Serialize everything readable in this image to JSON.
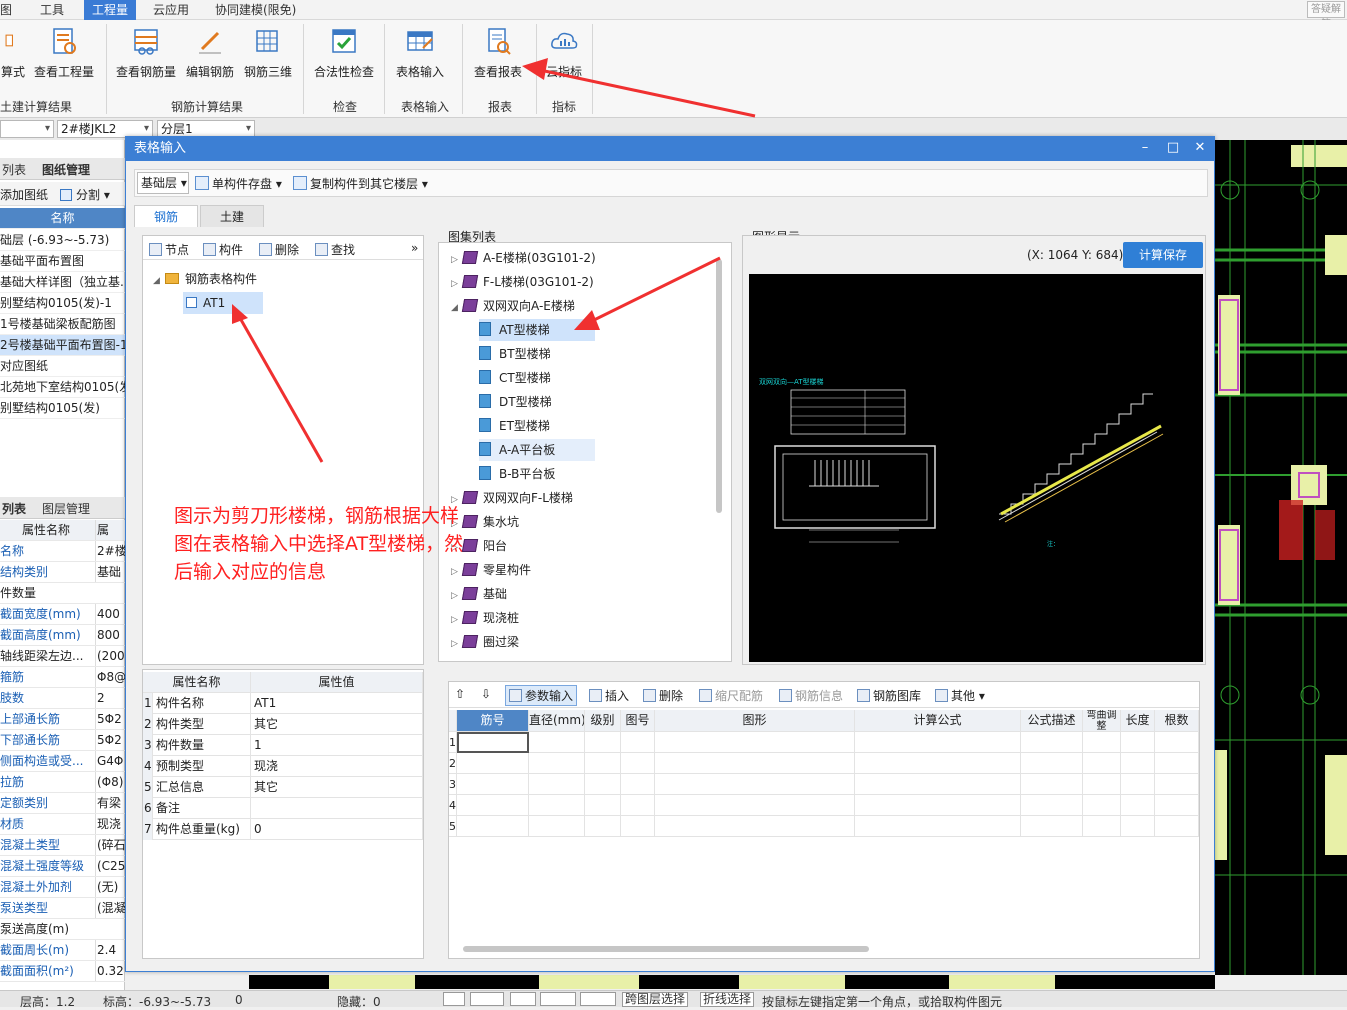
{
  "menubar": {
    "items": [
      "图",
      "工具",
      "工程量",
      "云应用",
      "协同建模(限免)"
    ],
    "active": "工程量",
    "hint": "答疑解答"
  },
  "ribbon": {
    "buttons": {
      "b0": "算式",
      "b1": "查看工程量",
      "b2": "查看钢筋量",
      "b3": "编辑钢筋",
      "b4": "钢筋三维",
      "b5": "合法性检查",
      "b6": "表格输入",
      "b7": "查看报表",
      "b8": "云指标"
    },
    "groups": {
      "g0": "土建计算结果",
      "g1": "钢筋计算结果",
      "g2": "检查",
      "g3": "表格输入",
      "g4": "报表",
      "g5": "指标"
    }
  },
  "row2": {
    "combo1": "",
    "combo2": "2#楼JKL2",
    "combo3": "分层1"
  },
  "leftpanel": {
    "tabs": {
      "t1": "列表",
      "t2": "图纸管理"
    },
    "tools": {
      "add": "添加图纸",
      "split": "分割"
    },
    "header": "名称",
    "items": [
      "础层 (-6.93~-5.73)",
      "基础平面布置图",
      "基础大样详图（独立基...",
      "别墅结构0105(发)-1",
      "1号楼基础梁板配筋图",
      "2号楼基础平面布置图-1",
      "对应图纸",
      "北苑地下室结构0105(发)",
      "别墅结构0105(发)"
    ],
    "tabs2": {
      "t1": "列表",
      "t2": "图层管理"
    },
    "prop_header": {
      "k": "属性名称",
      "v": "属"
    },
    "props": [
      {
        "k": "名称",
        "v": "2#楼",
        "blue": true
      },
      {
        "k": "结构类别",
        "v": "基础",
        "blue": true
      },
      {
        "k": "件数量",
        "v": "",
        "blue": false
      },
      {
        "k": "截面宽度(mm)",
        "v": "400",
        "blue": true
      },
      {
        "k": "截面高度(mm)",
        "v": "800",
        "blue": true
      },
      {
        "k": "轴线距梁左边...",
        "v": "(200)",
        "blue": false
      },
      {
        "k": "箍筋",
        "v": "Φ8@",
        "blue": true
      },
      {
        "k": "肢数",
        "v": "2",
        "blue": true
      },
      {
        "k": "上部通长筋",
        "v": "5Φ2",
        "blue": true
      },
      {
        "k": "下部通长筋",
        "v": "5Φ2",
        "blue": true
      },
      {
        "k": "侧面构造或受...",
        "v": "G4Φ",
        "blue": true
      },
      {
        "k": "拉筋",
        "v": "(Φ8)",
        "blue": true
      },
      {
        "k": "定额类别",
        "v": "有梁",
        "blue": true
      },
      {
        "k": "材质",
        "v": "现浇",
        "blue": true
      },
      {
        "k": "混凝土类型",
        "v": "(碎石",
        "blue": true
      },
      {
        "k": "混凝土强度等级",
        "v": "(C25)",
        "blue": true
      },
      {
        "k": "混凝土外加剂",
        "v": "(无)",
        "blue": true
      },
      {
        "k": "泵送类型",
        "v": "(混凝",
        "blue": true
      },
      {
        "k": "泵送高度(m)",
        "v": "",
        "blue": false
      },
      {
        "k": "截面周长(m)",
        "v": "2.4",
        "blue": true
      },
      {
        "k": "截面面积(m²)",
        "v": "0.32",
        "blue": true
      }
    ]
  },
  "dialog": {
    "title": "表格输入",
    "toolbar": {
      "floor": "基础层",
      "save": "单构件存盘",
      "copy": "复制构件到其它楼层"
    },
    "tabs": {
      "t1": "钢筋",
      "t2": "土建"
    },
    "tree_toolbar": {
      "node": "节点",
      "comp": "构件",
      "del": "删除",
      "find": "查找"
    },
    "tree": {
      "root": "钢筋表格构件",
      "child": "AT1"
    },
    "prop_grid": {
      "h1": "属性名称",
      "h2": "属性值",
      "rows": [
        {
          "n": "1",
          "k": "构件名称",
          "v": "AT1"
        },
        {
          "n": "2",
          "k": "构件类型",
          "v": "其它"
        },
        {
          "n": "3",
          "k": "构件数量",
          "v": "1"
        },
        {
          "n": "4",
          "k": "预制类型",
          "v": "现浇"
        },
        {
          "n": "5",
          "k": "汇总信息",
          "v": "其它"
        },
        {
          "n": "6",
          "k": "备注",
          "v": ""
        },
        {
          "n": "7",
          "k": "构件总重量(kg)",
          "v": "0"
        }
      ]
    },
    "atlas": {
      "label": "图集列表",
      "items": [
        {
          "t": "A-E楼梯(03G101-2)",
          "level": 0,
          "exp": "▷",
          "icon": "book"
        },
        {
          "t": "F-L楼梯(03G101-2)",
          "level": 0,
          "exp": "▷",
          "icon": "book"
        },
        {
          "t": "双网双向A-E楼梯",
          "level": 0,
          "exp": "◢",
          "icon": "book-open"
        },
        {
          "t": "AT型楼梯",
          "level": 1,
          "exp": "",
          "icon": "page",
          "sel": true
        },
        {
          "t": "BT型楼梯",
          "level": 1,
          "exp": "",
          "icon": "page"
        },
        {
          "t": "CT型楼梯",
          "level": 1,
          "exp": "",
          "icon": "page"
        },
        {
          "t": "DT型楼梯",
          "level": 1,
          "exp": "",
          "icon": "page"
        },
        {
          "t": "ET型楼梯",
          "level": 1,
          "exp": "",
          "icon": "page"
        },
        {
          "t": "A-A平台板",
          "level": 1,
          "exp": "",
          "icon": "page",
          "hl": true
        },
        {
          "t": "B-B平台板",
          "level": 1,
          "exp": "",
          "icon": "page"
        },
        {
          "t": "双网双向F-L楼梯",
          "level": 0,
          "exp": "▷",
          "icon": "book"
        },
        {
          "t": "集水坑",
          "level": 0,
          "exp": "▷",
          "icon": "book"
        },
        {
          "t": "阳台",
          "level": 0,
          "exp": "▷",
          "icon": "book"
        },
        {
          "t": "零星构件",
          "level": 0,
          "exp": "▷",
          "icon": "book"
        },
        {
          "t": "基础",
          "level": 0,
          "exp": "▷",
          "icon": "book"
        },
        {
          "t": "现浇桩",
          "level": 0,
          "exp": "▷",
          "icon": "book"
        },
        {
          "t": "圈过梁",
          "level": 0,
          "exp": "▷",
          "icon": "book"
        }
      ]
    },
    "figure": {
      "label": "图形显示",
      "coords": "(X: 1064 Y: 684)",
      "button": "计算保存",
      "drawing_title": "双网双向—AT型楼梯"
    },
    "rebar_toolbar": {
      "param": "参数输入",
      "insert": "插入",
      "del": "删除",
      "scale": "缩尺配筋",
      "info": "钢筋信息",
      "lib": "钢筋图库",
      "other": "其他"
    },
    "rebar_grid": {
      "cols": [
        "筋号",
        "直径(mm)",
        "级别",
        "图号",
        "图形",
        "计算公式",
        "公式描述",
        "弯曲调整",
        "长度",
        "根数"
      ],
      "rows": [
        "1",
        "2",
        "3",
        "4",
        "5"
      ]
    }
  },
  "annotation": "图示为剪刀形楼梯，钢筋根据大样图在表格输入中选择AT型楼梯，然后输入对应的信息",
  "status": {
    "floor": "层高：1.2",
    "elev": "标高：-6.93~-5.73",
    "zero": "0",
    "hidden": "隐藏：0",
    "cross": "跨图层选择",
    "poly": "折线选择",
    "msg": "按鼠标左键指定第一个角点，或拾取构件图元"
  }
}
